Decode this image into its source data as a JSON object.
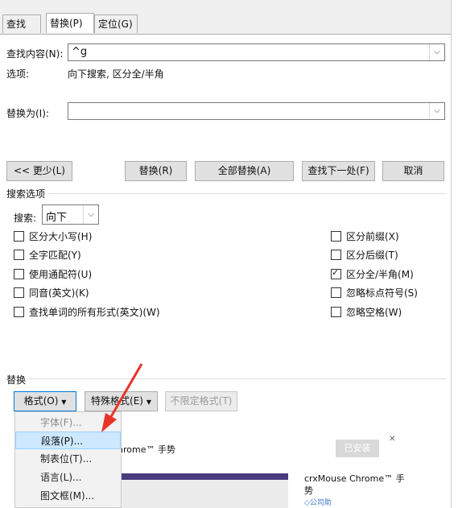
{
  "tabs": [
    {
      "label": "查找(D)"
    },
    {
      "label": "替换(P)"
    },
    {
      "label": "定位(G)"
    }
  ],
  "find": {
    "label": "查找内容(N):",
    "value": "^g"
  },
  "options": {
    "label": "选项:",
    "value": "向下搜索, 区分全/半角"
  },
  "replace": {
    "label": "替换为(I):",
    "value": ""
  },
  "buttons": {
    "less": "<< 更少(L)",
    "replace": "替换(R)",
    "replace_all": "全部替换(A)",
    "find_next": "查找下一处(F)",
    "cancel": "取消"
  },
  "search_options": {
    "title": "搜索选项",
    "search_label": "搜索:",
    "direction": "向下"
  },
  "checkboxes_left": [
    {
      "label": "区分大小写(H)",
      "checked": false
    },
    {
      "label": "全字匹配(Y)",
      "checked": false
    },
    {
      "label": "使用通配符(U)",
      "checked": false
    },
    {
      "label": "同音(英文)(K)",
      "checked": false
    },
    {
      "label": "查找单词的所有形式(英文)(W)",
      "checked": false
    }
  ],
  "checkboxes_right": [
    {
      "label": "区分前缀(X)",
      "checked": false
    },
    {
      "label": "区分后缀(T)",
      "checked": false
    },
    {
      "label": "区分全/半角(M)",
      "checked": true
    },
    {
      "label": "忽略标点符号(S)",
      "checked": false
    },
    {
      "label": "忽略空格(W)",
      "checked": false
    }
  ],
  "replace_section": {
    "title": "替换",
    "format": "格式(O)",
    "special": "特殊格式(E)",
    "no_format": "不限定格式(T)"
  },
  "format_menu": [
    {
      "label": "字体(F)...",
      "state": "dim"
    },
    {
      "label": "段落(P)...",
      "state": "highlighted"
    },
    {
      "label": "制表位(T)...",
      "state": "normal"
    },
    {
      "label": "语言(L)...",
      "state": "normal"
    },
    {
      "label": "图文框(M)...",
      "state": "normal"
    }
  ],
  "background": {
    "text1": "hrome™ 手势",
    "installed": "已安装",
    "ext_name": "crxMouse Chrome™ 手",
    "ext_name2": "势",
    "by": "◇公司助"
  },
  "colors": {
    "accent": "#0078d7",
    "arrow": "#e8332a",
    "highlight": "#cde8ff"
  }
}
